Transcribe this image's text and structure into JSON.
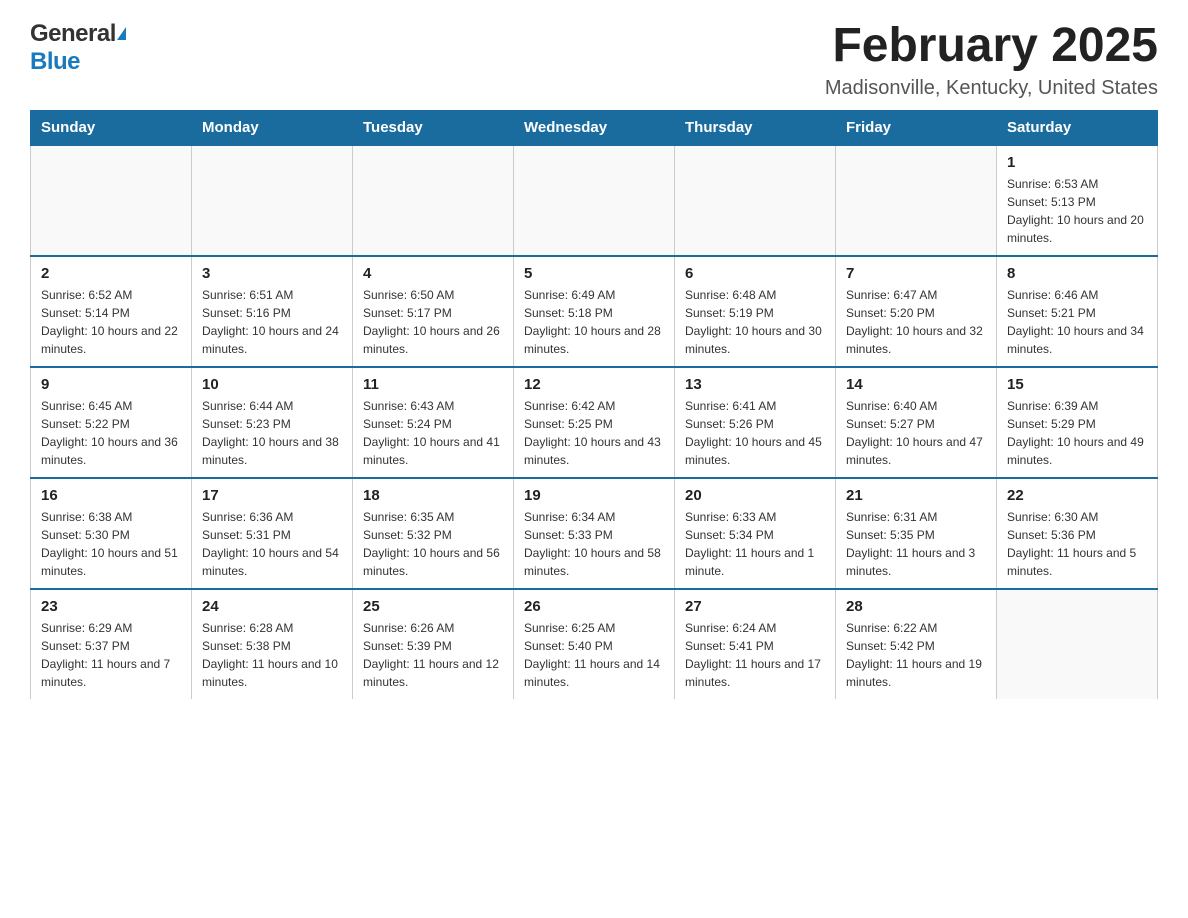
{
  "header": {
    "logo_general": "General",
    "logo_blue": "Blue",
    "month_title": "February 2025",
    "location": "Madisonville, Kentucky, United States"
  },
  "weekdays": [
    "Sunday",
    "Monday",
    "Tuesday",
    "Wednesday",
    "Thursday",
    "Friday",
    "Saturday"
  ],
  "weeks": [
    [
      {
        "day": "",
        "info": ""
      },
      {
        "day": "",
        "info": ""
      },
      {
        "day": "",
        "info": ""
      },
      {
        "day": "",
        "info": ""
      },
      {
        "day": "",
        "info": ""
      },
      {
        "day": "",
        "info": ""
      },
      {
        "day": "1",
        "info": "Sunrise: 6:53 AM\nSunset: 5:13 PM\nDaylight: 10 hours and 20 minutes."
      }
    ],
    [
      {
        "day": "2",
        "info": "Sunrise: 6:52 AM\nSunset: 5:14 PM\nDaylight: 10 hours and 22 minutes."
      },
      {
        "day": "3",
        "info": "Sunrise: 6:51 AM\nSunset: 5:16 PM\nDaylight: 10 hours and 24 minutes."
      },
      {
        "day": "4",
        "info": "Sunrise: 6:50 AM\nSunset: 5:17 PM\nDaylight: 10 hours and 26 minutes."
      },
      {
        "day": "5",
        "info": "Sunrise: 6:49 AM\nSunset: 5:18 PM\nDaylight: 10 hours and 28 minutes."
      },
      {
        "day": "6",
        "info": "Sunrise: 6:48 AM\nSunset: 5:19 PM\nDaylight: 10 hours and 30 minutes."
      },
      {
        "day": "7",
        "info": "Sunrise: 6:47 AM\nSunset: 5:20 PM\nDaylight: 10 hours and 32 minutes."
      },
      {
        "day": "8",
        "info": "Sunrise: 6:46 AM\nSunset: 5:21 PM\nDaylight: 10 hours and 34 minutes."
      }
    ],
    [
      {
        "day": "9",
        "info": "Sunrise: 6:45 AM\nSunset: 5:22 PM\nDaylight: 10 hours and 36 minutes."
      },
      {
        "day": "10",
        "info": "Sunrise: 6:44 AM\nSunset: 5:23 PM\nDaylight: 10 hours and 38 minutes."
      },
      {
        "day": "11",
        "info": "Sunrise: 6:43 AM\nSunset: 5:24 PM\nDaylight: 10 hours and 41 minutes."
      },
      {
        "day": "12",
        "info": "Sunrise: 6:42 AM\nSunset: 5:25 PM\nDaylight: 10 hours and 43 minutes."
      },
      {
        "day": "13",
        "info": "Sunrise: 6:41 AM\nSunset: 5:26 PM\nDaylight: 10 hours and 45 minutes."
      },
      {
        "day": "14",
        "info": "Sunrise: 6:40 AM\nSunset: 5:27 PM\nDaylight: 10 hours and 47 minutes."
      },
      {
        "day": "15",
        "info": "Sunrise: 6:39 AM\nSunset: 5:29 PM\nDaylight: 10 hours and 49 minutes."
      }
    ],
    [
      {
        "day": "16",
        "info": "Sunrise: 6:38 AM\nSunset: 5:30 PM\nDaylight: 10 hours and 51 minutes."
      },
      {
        "day": "17",
        "info": "Sunrise: 6:36 AM\nSunset: 5:31 PM\nDaylight: 10 hours and 54 minutes."
      },
      {
        "day": "18",
        "info": "Sunrise: 6:35 AM\nSunset: 5:32 PM\nDaylight: 10 hours and 56 minutes."
      },
      {
        "day": "19",
        "info": "Sunrise: 6:34 AM\nSunset: 5:33 PM\nDaylight: 10 hours and 58 minutes."
      },
      {
        "day": "20",
        "info": "Sunrise: 6:33 AM\nSunset: 5:34 PM\nDaylight: 11 hours and 1 minute."
      },
      {
        "day": "21",
        "info": "Sunrise: 6:31 AM\nSunset: 5:35 PM\nDaylight: 11 hours and 3 minutes."
      },
      {
        "day": "22",
        "info": "Sunrise: 6:30 AM\nSunset: 5:36 PM\nDaylight: 11 hours and 5 minutes."
      }
    ],
    [
      {
        "day": "23",
        "info": "Sunrise: 6:29 AM\nSunset: 5:37 PM\nDaylight: 11 hours and 7 minutes."
      },
      {
        "day": "24",
        "info": "Sunrise: 6:28 AM\nSunset: 5:38 PM\nDaylight: 11 hours and 10 minutes."
      },
      {
        "day": "25",
        "info": "Sunrise: 6:26 AM\nSunset: 5:39 PM\nDaylight: 11 hours and 12 minutes."
      },
      {
        "day": "26",
        "info": "Sunrise: 6:25 AM\nSunset: 5:40 PM\nDaylight: 11 hours and 14 minutes."
      },
      {
        "day": "27",
        "info": "Sunrise: 6:24 AM\nSunset: 5:41 PM\nDaylight: 11 hours and 17 minutes."
      },
      {
        "day": "28",
        "info": "Sunrise: 6:22 AM\nSunset: 5:42 PM\nDaylight: 11 hours and 19 minutes."
      },
      {
        "day": "",
        "info": ""
      }
    ]
  ]
}
